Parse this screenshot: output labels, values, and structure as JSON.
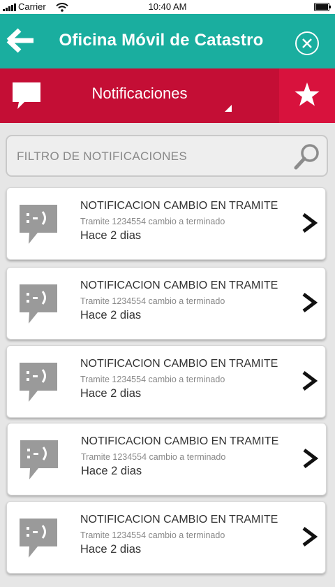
{
  "status_bar": {
    "carrier": "Carrier",
    "time": "10:40 AM"
  },
  "header": {
    "title": "Oficina Móvil de Catastro",
    "back_icon": "arrow-left-icon",
    "close_icon": "close-circle-icon",
    "color": "#1aae9f"
  },
  "section": {
    "title": "Notificaciones",
    "chat_icon": "chat-bubble-icon",
    "star_icon": "star-icon",
    "color": "#c40e35"
  },
  "filter": {
    "placeholder": "FILTRO DE NOTIFICACIONES",
    "search_icon": "search-icon"
  },
  "notifications": [
    {
      "title": "NOTIFICACION CAMBIO EN TRAMITE",
      "subtitle": "Tramite 1234554 cambio a terminado",
      "time": "Hace 2 dias"
    },
    {
      "title": "NOTIFICACION CAMBIO EN TRAMITE",
      "subtitle": "Tramite 1234554 cambio a terminado",
      "time": "Hace 2 dias"
    },
    {
      "title": "NOTIFICACION CAMBIO EN TRAMITE",
      "subtitle": "Tramite 1234554 cambio a terminado",
      "time": "Hace 2 dias"
    },
    {
      "title": "NOTIFICACION CAMBIO EN TRAMITE",
      "subtitle": "Tramite 1234554 cambio a terminado",
      "time": "Hace 2 dias"
    },
    {
      "title": "NOTIFICACION CAMBIO EN TRAMITE",
      "subtitle": "Tramite 1234554 cambio a terminado",
      "time": "Hace 2 dias"
    }
  ]
}
